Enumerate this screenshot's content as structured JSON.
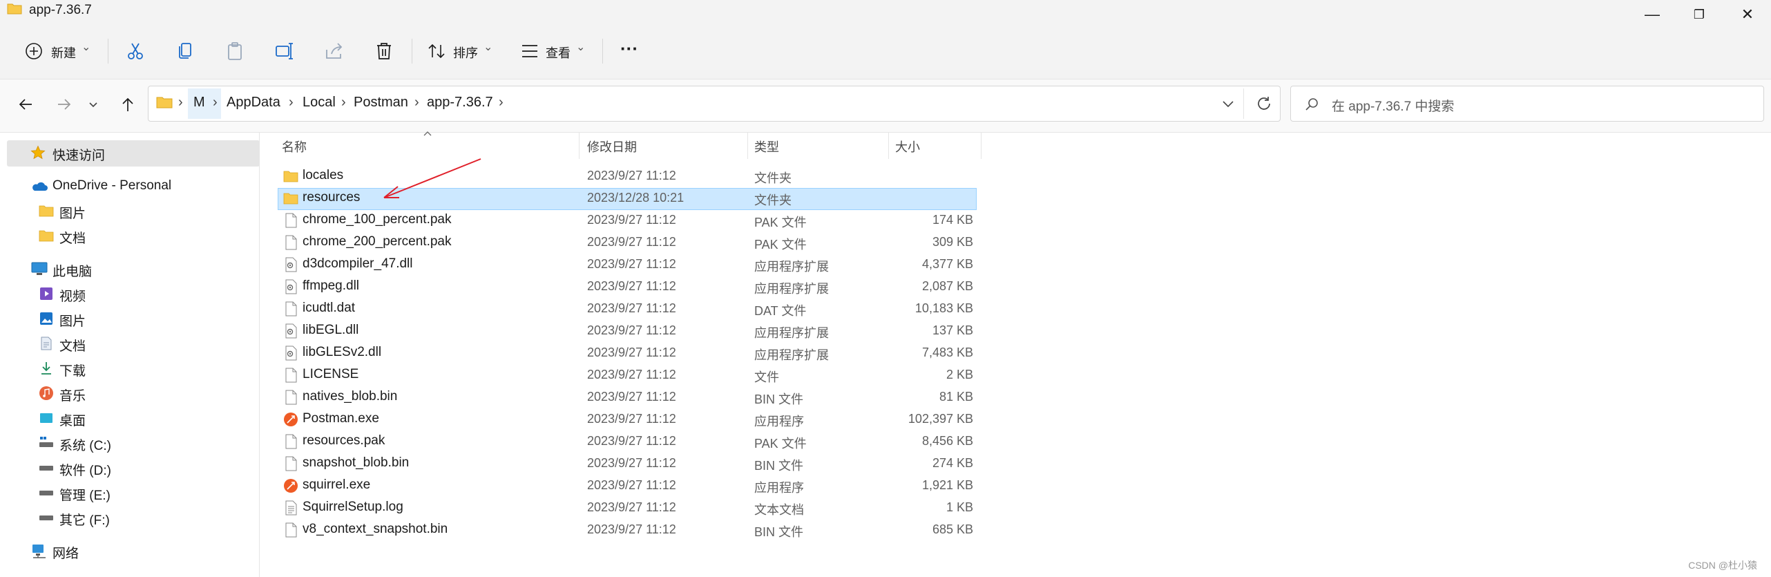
{
  "window": {
    "title": "app-7.36.7",
    "minimize_glyph": "—",
    "maximize_glyph": "❐",
    "close_glyph": "✕"
  },
  "toolbar": {
    "new_label": "新建",
    "sort_label": "排序",
    "view_label": "查看",
    "more_glyph": "···",
    "chevron": "⌄"
  },
  "address": {
    "crumbs": [
      "M",
      "AppData",
      "Local",
      "Postman",
      "app-7.36.7"
    ],
    "separator": "›",
    "search_placeholder": "在 app-7.36.7 中搜索"
  },
  "sidebar": {
    "quick_access": "快速访问",
    "onedrive": "OneDrive - Personal",
    "onedrive_items": [
      "图片",
      "文档"
    ],
    "this_pc": "此电脑",
    "pc_items": [
      "视频",
      "图片",
      "文档",
      "下载",
      "音乐",
      "桌面",
      "系统 (C:)",
      "软件 (D:)",
      "管理 (E:)",
      "其它 (F:)"
    ],
    "network": "网络"
  },
  "columns": {
    "name": "名称",
    "modified": "修改日期",
    "type": "类型",
    "size": "大小"
  },
  "files": [
    {
      "name": "locales",
      "date": "2023/9/27 11:12",
      "type": "文件夹",
      "size": "",
      "icon": "folder-icon"
    },
    {
      "name": "resources",
      "date": "2023/12/28 10:21",
      "type": "文件夹",
      "size": "",
      "icon": "folder-icon"
    },
    {
      "name": "chrome_100_percent.pak",
      "date": "2023/9/27 11:12",
      "type": "PAK 文件",
      "size": "174 KB",
      "icon": "file-icon"
    },
    {
      "name": "chrome_200_percent.pak",
      "date": "2023/9/27 11:12",
      "type": "PAK 文件",
      "size": "309 KB",
      "icon": "file-icon"
    },
    {
      "name": "d3dcompiler_47.dll",
      "date": "2023/9/27 11:12",
      "type": "应用程序扩展",
      "size": "4,377 KB",
      "icon": "dll-icon"
    },
    {
      "name": "ffmpeg.dll",
      "date": "2023/9/27 11:12",
      "type": "应用程序扩展",
      "size": "2,087 KB",
      "icon": "dll-icon"
    },
    {
      "name": "icudtl.dat",
      "date": "2023/9/27 11:12",
      "type": "DAT 文件",
      "size": "10,183 KB",
      "icon": "file-icon"
    },
    {
      "name": "libEGL.dll",
      "date": "2023/9/27 11:12",
      "type": "应用程序扩展",
      "size": "137 KB",
      "icon": "dll-icon"
    },
    {
      "name": "libGLESv2.dll",
      "date": "2023/9/27 11:12",
      "type": "应用程序扩展",
      "size": "7,483 KB",
      "icon": "dll-icon"
    },
    {
      "name": "LICENSE",
      "date": "2023/9/27 11:12",
      "type": "文件",
      "size": "2 KB",
      "icon": "file-icon"
    },
    {
      "name": "natives_blob.bin",
      "date": "2023/9/27 11:12",
      "type": "BIN 文件",
      "size": "81 KB",
      "icon": "file-icon"
    },
    {
      "name": "Postman.exe",
      "date": "2023/9/27 11:12",
      "type": "应用程序",
      "size": "102,397 KB",
      "icon": "postman-icon"
    },
    {
      "name": "resources.pak",
      "date": "2023/9/27 11:12",
      "type": "PAK 文件",
      "size": "8,456 KB",
      "icon": "file-icon"
    },
    {
      "name": "snapshot_blob.bin",
      "date": "2023/9/27 11:12",
      "type": "BIN 文件",
      "size": "274 KB",
      "icon": "file-icon"
    },
    {
      "name": "squirrel.exe",
      "date": "2023/9/27 11:12",
      "type": "应用程序",
      "size": "1,921 KB",
      "icon": "postman-icon"
    },
    {
      "name": "SquirrelSetup.log",
      "date": "2023/9/27 11:12",
      "type": "文本文档",
      "size": "1 KB",
      "icon": "text-file-icon"
    },
    {
      "name": "v8_context_snapshot.bin",
      "date": "2023/9/27 11:12",
      "type": "BIN 文件",
      "size": "685 KB",
      "icon": "file-icon"
    }
  ],
  "selected_file": "resources",
  "watermark": "CSDN @杜小猿",
  "colors": {
    "selection": "#cce8ff",
    "selection_border": "#99d1ff",
    "annotation_arrow": "#e0202a",
    "folder": "#f8c94a",
    "postman": "#ef5b25"
  }
}
